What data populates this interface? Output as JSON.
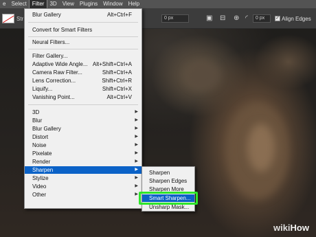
{
  "menubar": {
    "items": [
      {
        "label": "e"
      },
      {
        "label": "Select"
      },
      {
        "label": "Filter",
        "active": true
      },
      {
        "label": "3D"
      },
      {
        "label": "View"
      },
      {
        "label": "Plugins"
      },
      {
        "label": "Window"
      },
      {
        "label": "Help"
      }
    ]
  },
  "options_bar": {
    "stroke_label": "Str",
    "field1_value": "0 px",
    "field2_value": "0 px",
    "align_edges_checked": true,
    "align_edges_label": "Align Edges"
  },
  "filter_menu": {
    "last_filter": {
      "label": "Blur Gallery",
      "shortcut": "Alt+Ctrl+F"
    },
    "convert_smart": {
      "label": "Convert for Smart Filters"
    },
    "neural": {
      "label": "Neural Filters..."
    },
    "group_filters": [
      {
        "label": "Filter Gallery...",
        "shortcut": ""
      },
      {
        "label": "Adaptive Wide Angle...",
        "shortcut": "Alt+Shift+Ctrl+A"
      },
      {
        "label": "Camera Raw Filter...",
        "shortcut": "Shift+Ctrl+A"
      },
      {
        "label": "Lens Correction...",
        "shortcut": "Shift+Ctrl+R"
      },
      {
        "label": "Liquify...",
        "shortcut": "Shift+Ctrl+X"
      },
      {
        "label": "Vanishing Point...",
        "shortcut": "Alt+Ctrl+V"
      }
    ],
    "group_submenus": [
      {
        "label": "3D"
      },
      {
        "label": "Blur"
      },
      {
        "label": "Blur Gallery"
      },
      {
        "label": "Distort"
      },
      {
        "label": "Noise"
      },
      {
        "label": "Pixelate"
      },
      {
        "label": "Render"
      },
      {
        "label": "Sharpen",
        "highlighted": true
      },
      {
        "label": "Stylize"
      },
      {
        "label": "Video"
      },
      {
        "label": "Other"
      }
    ]
  },
  "sharpen_submenu": {
    "items": [
      {
        "label": "Sharpen"
      },
      {
        "label": "Sharpen Edges"
      },
      {
        "label": "Sharpen More"
      },
      {
        "label": "Smart Sharpen...",
        "highlighted": true
      },
      {
        "label": "Unsharp Mask..."
      }
    ]
  },
  "watermark": {
    "part1": "wiki",
    "part2": "How"
  },
  "colors": {
    "highlight": "#0b62c7",
    "callout": "#2ee62a",
    "menubar_bg": "#535353",
    "options_bg": "#3c3c3c",
    "menu_bg": "#f0f0f0"
  }
}
